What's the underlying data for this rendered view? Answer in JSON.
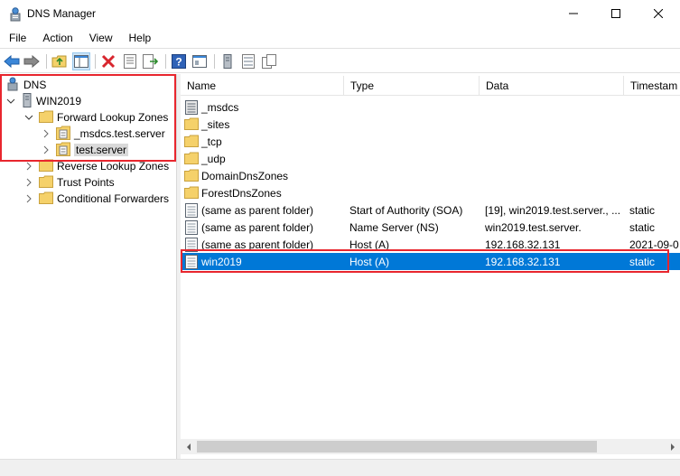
{
  "window": {
    "title": "DNS Manager",
    "icon": "dns-manager-icon"
  },
  "menu": {
    "items": [
      "File",
      "Action",
      "View",
      "Help"
    ]
  },
  "toolbar": {
    "buttons": [
      "back-icon",
      "forward-icon",
      "up-folder-icon",
      "show-hide-tree-icon",
      "delete-icon",
      "properties-icon",
      "export-list-icon",
      "help-icon",
      "view-icon",
      "server-icon",
      "copy-icon"
    ]
  },
  "tree": {
    "root": "DNS",
    "server": "WIN2019",
    "forward_zones": "Forward Lookup Zones",
    "zone_msdcs": "_msdcs.test.server",
    "zone_test": "test.server",
    "reverse_zones": "Reverse Lookup Zones",
    "trust_points": "Trust Points",
    "conditional_forwarders": "Conditional Forwarders"
  },
  "list": {
    "columns": {
      "name": "Name",
      "type": "Type",
      "data": "Data",
      "timestamp": "Timestam"
    },
    "rows": [
      {
        "name": "_msdcs",
        "type": "",
        "data": "",
        "timestamp": "",
        "icon": "zone-icon"
      },
      {
        "name": "_sites",
        "type": "",
        "data": "",
        "timestamp": "",
        "icon": "folder-icon"
      },
      {
        "name": "_tcp",
        "type": "",
        "data": "",
        "timestamp": "",
        "icon": "folder-icon"
      },
      {
        "name": "_udp",
        "type": "",
        "data": "",
        "timestamp": "",
        "icon": "folder-icon"
      },
      {
        "name": "DomainDnsZones",
        "type": "",
        "data": "",
        "timestamp": "",
        "icon": "folder-icon"
      },
      {
        "name": "ForestDnsZones",
        "type": "",
        "data": "",
        "timestamp": "",
        "icon": "folder-icon"
      },
      {
        "name": "(same as parent folder)",
        "type": "Start of Authority (SOA)",
        "data": "[19], win2019.test.server., ...",
        "timestamp": "static",
        "icon": "record-icon"
      },
      {
        "name": "(same as parent folder)",
        "type": "Name Server (NS)",
        "data": "win2019.test.server.",
        "timestamp": "static",
        "icon": "record-icon"
      },
      {
        "name": "(same as parent folder)",
        "type": "Host (A)",
        "data": "192.168.32.131",
        "timestamp": "2021-09-0",
        "icon": "record-icon"
      },
      {
        "name": "win2019",
        "type": "Host (A)",
        "data": "192.168.32.131",
        "timestamp": "static",
        "icon": "record-icon",
        "selected": true
      }
    ]
  },
  "colors": {
    "selection": "#0078d7",
    "highlight_box": "#e8262e",
    "folder": "#f5d16a"
  }
}
